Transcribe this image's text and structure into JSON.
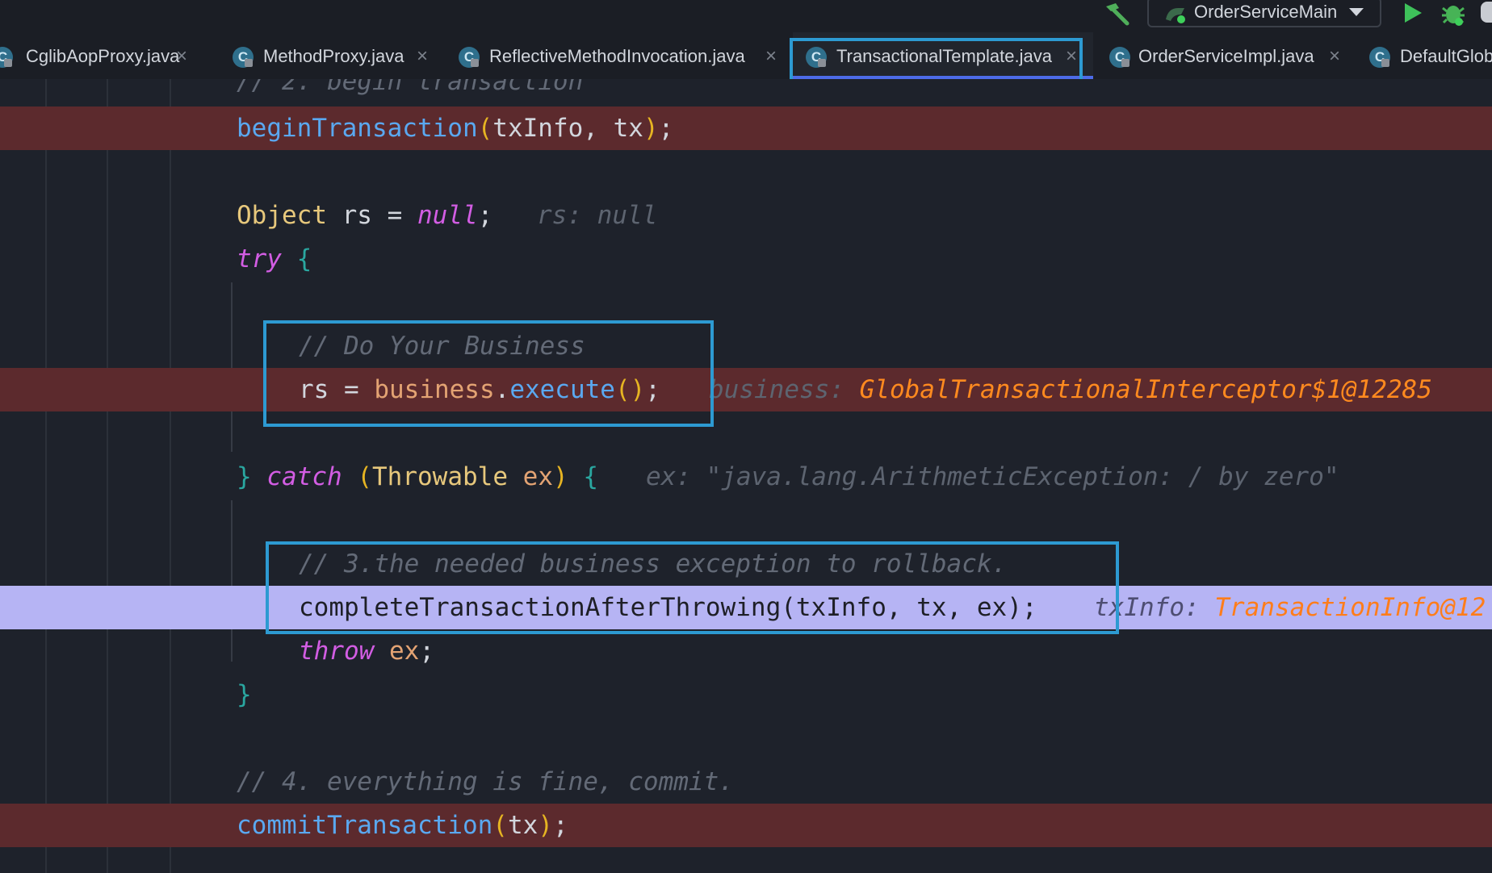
{
  "toolbar": {
    "run_config_label": "OrderServiceMain",
    "icons": [
      "hammer-icon",
      "run-config-icon",
      "chevron-down-icon",
      "run-icon",
      "debug-icon"
    ]
  },
  "tabs": [
    {
      "label": "CglibAopProxy.java",
      "active": false
    },
    {
      "label": "MethodProxy.java",
      "active": false
    },
    {
      "label": "ReflectiveMethodInvocation.java",
      "active": false
    },
    {
      "label": "TransactionalTemplate.java",
      "active": true
    },
    {
      "label": "OrderServiceImpl.java",
      "active": false
    },
    {
      "label": "DefaultGlob",
      "active": false
    }
  ],
  "tab_icon_letter": "C",
  "tab_close_glyph": "×",
  "code": {
    "l1": {
      "text": "// 2. begin transaction"
    },
    "l2": {
      "fn": "beginTransaction",
      "args": "txInfo, tx",
      "end": ";"
    },
    "l4": {
      "type": "Object",
      "mid": " rs = ",
      "kw": "null",
      "end": ";",
      "inlay": "rs: null"
    },
    "l5": {
      "kw": "try",
      "brace": "{"
    },
    "l7": {
      "text": "// Do Your Business"
    },
    "l8": {
      "pre": "rs = ",
      "var": "business",
      "dot": ".",
      "fn": "execute",
      "end": ";",
      "inlay": "business: ",
      "inlay_val": "GlobalTransactionalInterceptor$1@12285"
    },
    "l10": {
      "brace_close": "}",
      "kw": "catch",
      "type": "Throwable",
      "var": "ex",
      "brace_open": "{",
      "inlay": "ex: \"java.lang.ArithmeticException: / by zero\""
    },
    "l12": {
      "text": "// 3.the needed business exception to rollback."
    },
    "l13": {
      "text": "completeTransactionAfterThrowing(txInfo, tx, ex);",
      "inlay": "txInfo: ",
      "inlay_val": "TransactionInfo@12"
    },
    "l14": {
      "kw": "throw",
      "var": "ex",
      "end": ";"
    },
    "l15": {
      "brace": "}"
    },
    "l17": {
      "text": "// 4. everything is fine, commit."
    },
    "l18": {
      "fn": "commitTransaction",
      "args": "tx",
      "end": ";"
    }
  },
  "colors": {
    "breakpoint_line": "#5c2a2d",
    "current_line": "#b6b4f4",
    "highlight_box": "#2d9ad2",
    "active_tab_underline": "#4d6be8"
  }
}
